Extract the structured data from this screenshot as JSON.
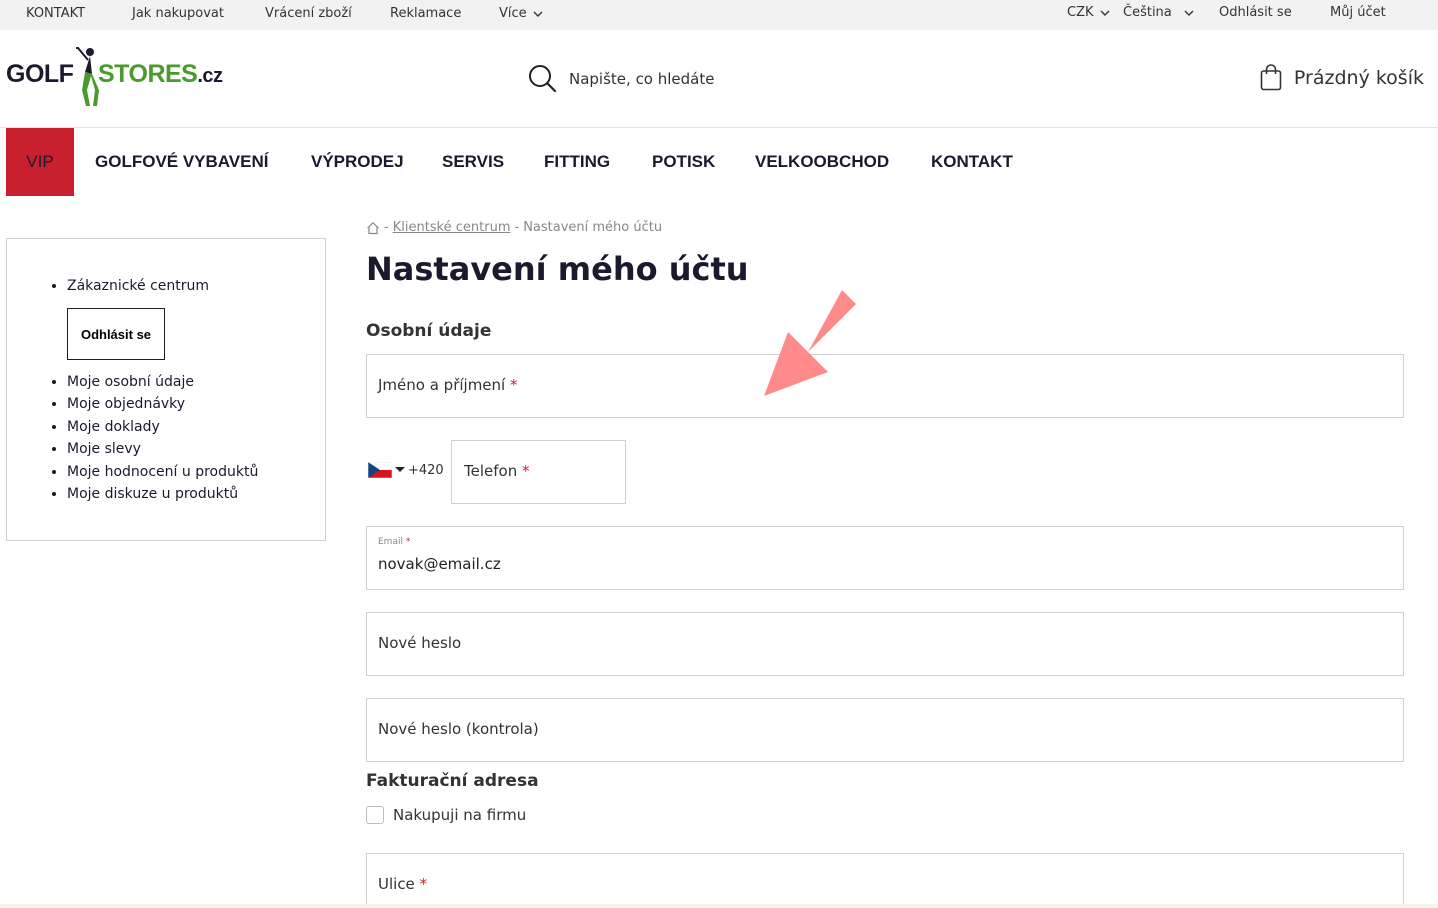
{
  "topbar": {
    "contact": "KONTAKT",
    "how_to_buy": "Jak nakupovat",
    "returns": "Vrácení zboží",
    "complaints": "Reklamace",
    "more": "Více",
    "currency": "CZK",
    "language": "Čeština",
    "logout": "Odhlásit se",
    "my_account": "Můj účet"
  },
  "header": {
    "logo_left": "GOLF",
    "logo_right": "STORES",
    "logo_suffix": ".cz",
    "search_placeholder": "Napište, co hledáte",
    "cart": "Prázdný košík"
  },
  "nav": {
    "vip": "VIP",
    "items": [
      "GOLFOVÉ VYBAVENÍ",
      "VÝPRODEJ",
      "SERVIS",
      "FITTING",
      "POTISK",
      "VELKOOBCHOD",
      "KONTAKT"
    ]
  },
  "sidebar": {
    "customer_center": "Zákaznické centrum",
    "logout_button": "Odhlásit se",
    "items": [
      "Moje osobní údaje",
      "Moje objednávky",
      "Moje doklady",
      "Moje slevy",
      "Moje hodnocení u produktů",
      "Moje diskuze u produktů"
    ]
  },
  "breadcrumb": {
    "separator": "-",
    "client_center": "Klientské centrum",
    "current": "Nastavení mého účtu"
  },
  "page": {
    "title": "Nastavení mého účtu",
    "personal_section": "Osobní údaje",
    "billing_section": "Fakturační adresa"
  },
  "form": {
    "required_mark": "*",
    "name_label": "Jméno a příjmení",
    "phone_prefix": "+420",
    "phone_label": "Telefon",
    "email_label": "Email",
    "email_value": "novak@email.cz",
    "new_password_label": "Nové heslo",
    "new_password_check_label": "Nové heslo (kontrola)",
    "company_checkbox_label": "Nakupuji na firmu",
    "street_label": "Ulice"
  },
  "colors": {
    "accent_red": "#c8202e",
    "logo_green": "#4a9a2c",
    "arrow": "#ff8a8a"
  }
}
